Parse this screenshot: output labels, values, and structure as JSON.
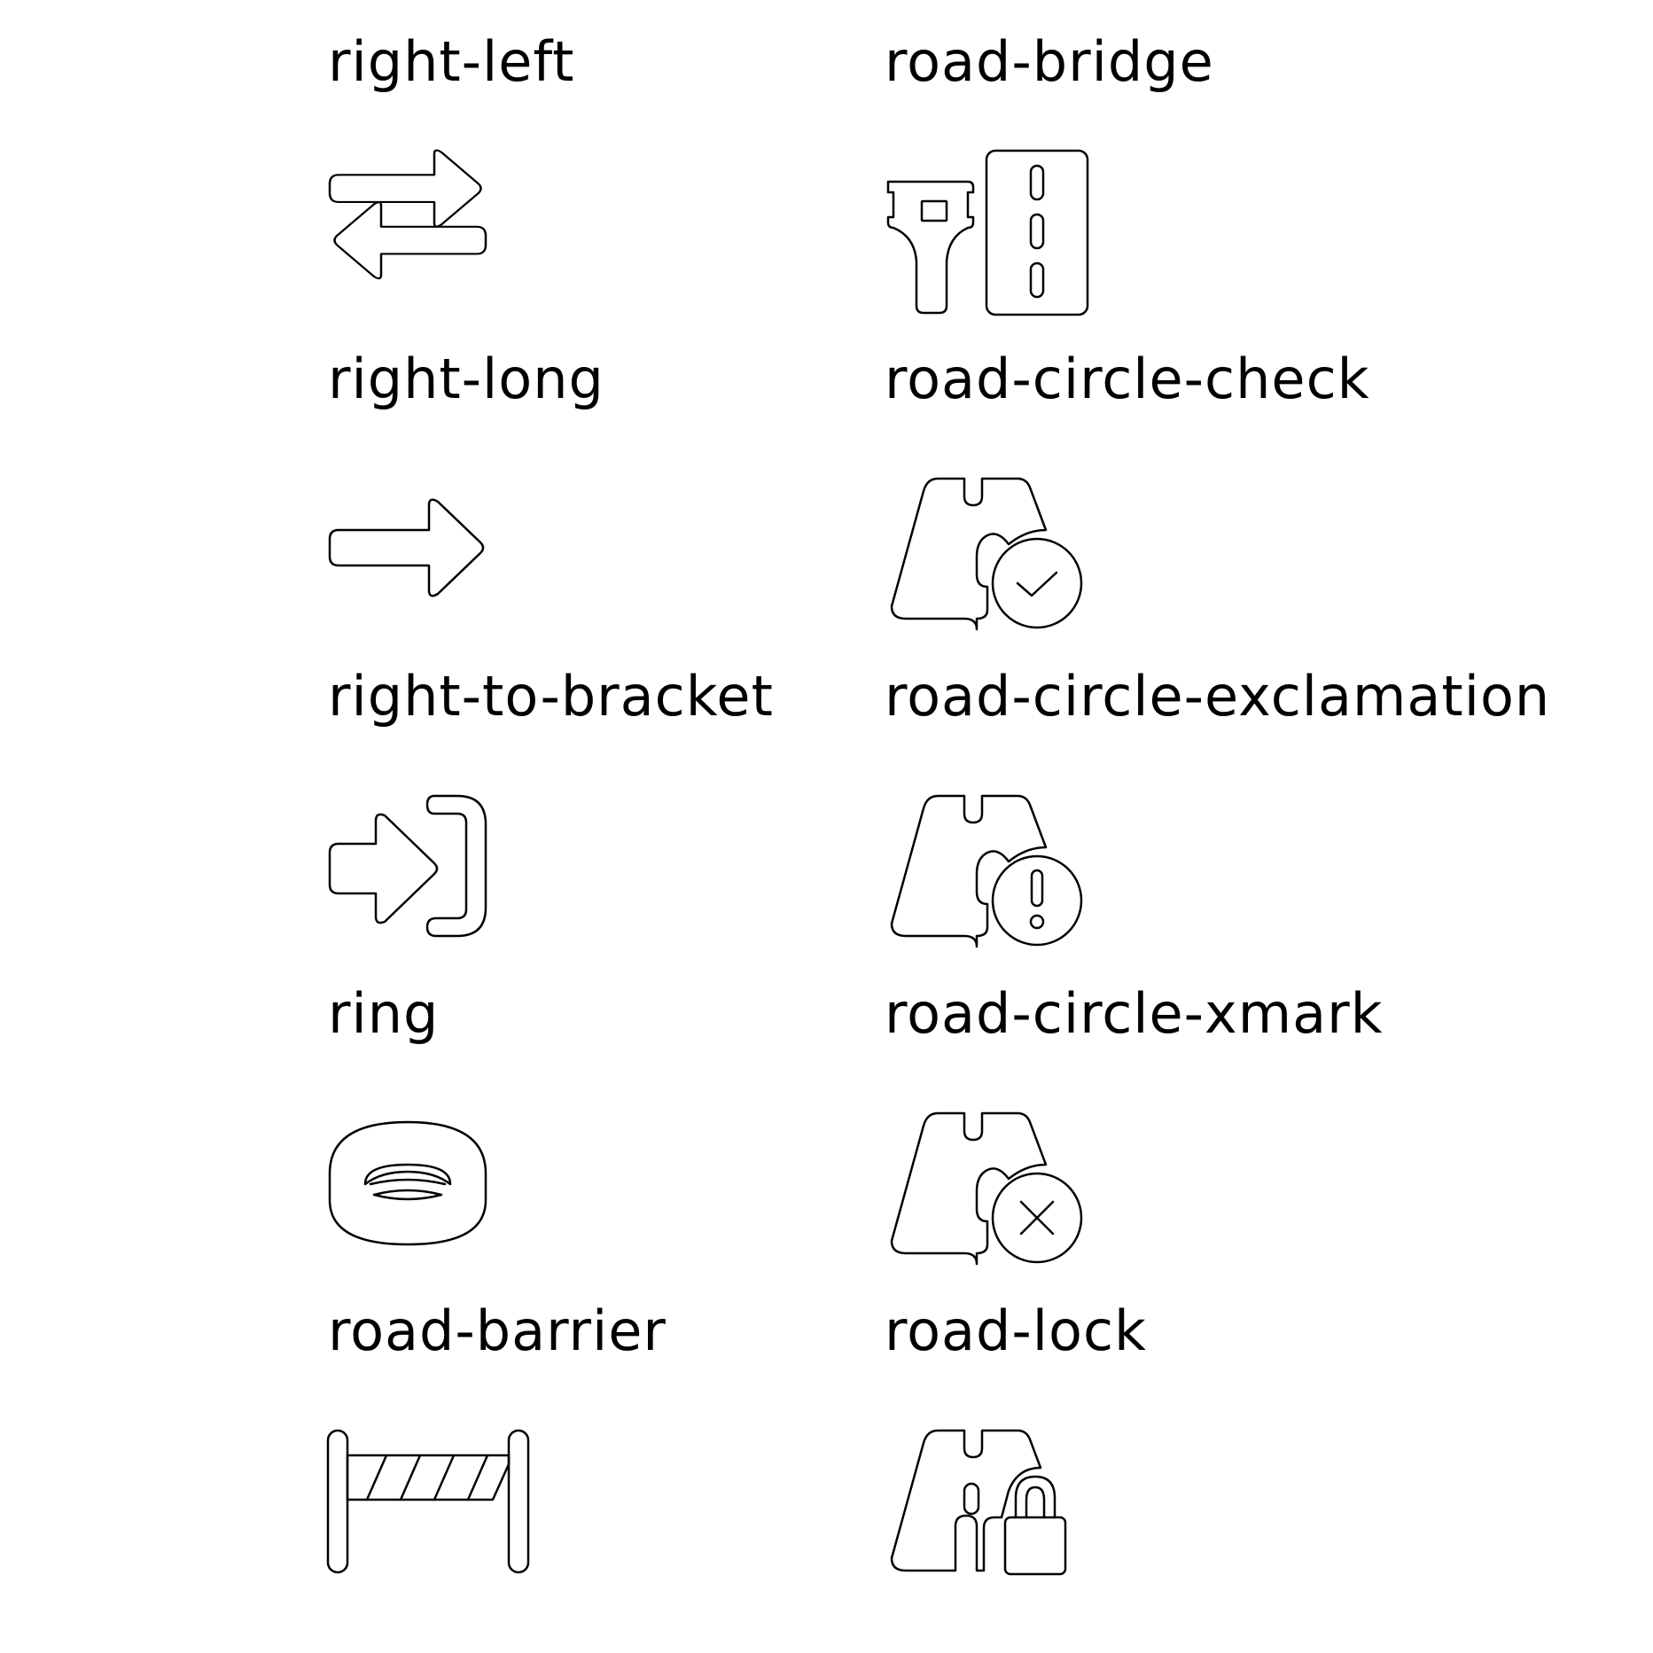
{
  "colors": {
    "background": "#ffffff",
    "ink": "#000000"
  },
  "icons": [
    {
      "name": "right-left",
      "icon": "right-left-icon"
    },
    {
      "name": "road-bridge",
      "icon": "road-bridge-icon"
    },
    {
      "name": "right-long",
      "icon": "right-long-icon"
    },
    {
      "name": "road-circle-check",
      "icon": "road-circle-check-icon"
    },
    {
      "name": "right-to-bracket",
      "icon": "right-to-bracket-icon"
    },
    {
      "name": "road-circle-exclamation",
      "icon": "road-circle-exclamation-icon"
    },
    {
      "name": "ring",
      "icon": "ring-icon"
    },
    {
      "name": "road-circle-xmark",
      "icon": "road-circle-xmark-icon"
    },
    {
      "name": "road-barrier",
      "icon": "road-barrier-icon"
    },
    {
      "name": "road-lock",
      "icon": "road-lock-icon"
    }
  ]
}
